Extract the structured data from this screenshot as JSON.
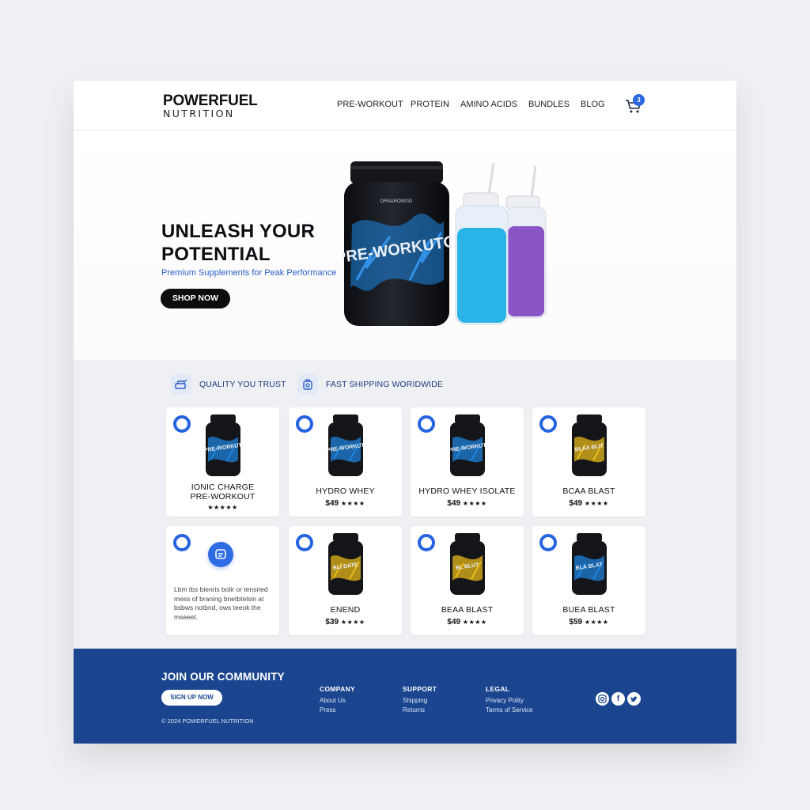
{
  "brand": {
    "name": "POWERFUEL",
    "sub": "NUTRITION"
  },
  "nav": [
    {
      "label": "PRE-WORKOUT"
    },
    {
      "label": "PROTEIN"
    },
    {
      "label": "AMINO ACIDS"
    },
    {
      "label": "BUNDLES"
    },
    {
      "label": "BLOG"
    }
  ],
  "cart": {
    "count": "3",
    "icon": "cart-icon"
  },
  "hero": {
    "title_line1": "UNLEASH YOUR",
    "title_line2": "POTENTIAL",
    "subtitle": "Premium Supplements for Peak Performance",
    "cta": "SHOP NOW",
    "product_label": "PRE-WORKUTO",
    "product_brand": "DRNAROWGD"
  },
  "badges": [
    {
      "label": "QUALITY YOU TRUST",
      "icon": "quality-icon"
    },
    {
      "label": "FAST SHIPPING WORIDWIDE",
      "icon": "shipping-icon"
    }
  ],
  "products": [
    {
      "name_line1": "IONIC CHARGE",
      "name_line2": "PRE-WORKOUT",
      "price": "",
      "stars": "★★★★★",
      "jar_label": "PRE-WORKUT",
      "accent": "#1e88e5"
    },
    {
      "name_line1": "HYDRO WHEY",
      "name_line2": "",
      "price": "$49",
      "stars": "★★★★",
      "jar_label": "PRE-WORKUT",
      "accent": "#1e88e5"
    },
    {
      "name_line1": "HYDRO WHEY ISOLATE",
      "name_line2": "",
      "price": "$49",
      "stars": "★★★★",
      "jar_label": "PRE-WORKUT",
      "accent": "#1e88e5"
    },
    {
      "name_line1": "BCAA BLAST",
      "name_line2": "",
      "price": "$49",
      "stars": "★★★★",
      "jar_label": "BLAA BLIT",
      "accent": "#f2c21b"
    },
    {
      "info_text": "Lbm tbs bienris bolir or tensried mess of braning bnetbtelsin at bsbws notbnd, ows teeok the mseeet."
    },
    {
      "name_line1": "ENEND",
      "name_line2": "",
      "price": "$39",
      "stars": "★★★★",
      "jar_label": "BLI DATE",
      "accent": "#f2c21b"
    },
    {
      "name_line1": "BEAA BLAST",
      "name_line2": "",
      "price": "$49",
      "stars": "★★★★",
      "jar_label": "BL BLUT",
      "accent": "#f2c21b"
    },
    {
      "name_line1": "BUEA BLAST",
      "name_line2": "",
      "price": "$59",
      "stars": "★★★★",
      "jar_label": "BLA BLAT",
      "accent": "#1e88e5"
    }
  ],
  "footer": {
    "title": "JOIN OUR COMMUNITY",
    "cta": "SIGN UP NOW",
    "copyright": "© 2024 POWERFUEL NUTRITION",
    "columns": [
      {
        "heading": "COMPANY",
        "links": [
          "About Us",
          "Press"
        ]
      },
      {
        "heading": "SUPPORT",
        "links": [
          "Shipping",
          "Returns"
        ]
      },
      {
        "heading": "LEGAL",
        "links": [
          "Pnvacy Polity",
          "Tarms of Service"
        ]
      }
    ],
    "social": [
      "instagram-icon",
      "facebook-icon",
      "twitter-icon"
    ]
  }
}
